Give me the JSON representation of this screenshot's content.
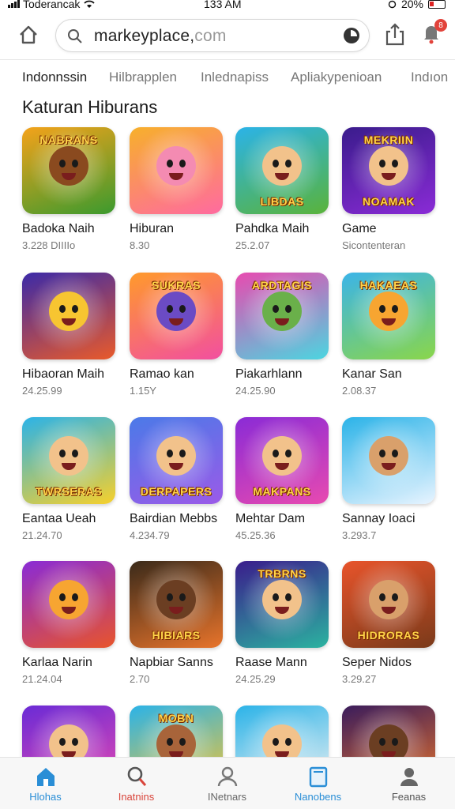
{
  "status_bar": {
    "carrier": "Toderancak",
    "time": "133 AM",
    "battery": "20%"
  },
  "browser": {
    "url_main": "markeyplace,",
    "url_dim": "com",
    "notification_count": "8"
  },
  "tabs": [
    {
      "label": "Indonnssin",
      "active": true
    },
    {
      "label": "Hilbrapplen",
      "active": false
    },
    {
      "label": "Inlednapiss",
      "active": false
    },
    {
      "label": "Apliakypenioan",
      "active": false
    },
    {
      "label": "Indıon",
      "active": false
    }
  ],
  "section": {
    "title": "Katuran Hiburans"
  },
  "apps": [
    {
      "name": "Badoka Naih",
      "meta": "3.228 DIIIIo",
      "banner_top": "NABRANS",
      "banner_bottom": "",
      "bg": [
        "#f4a21a",
        "#3b9a2e"
      ],
      "face": "#8a4a1f"
    },
    {
      "name": "Hiburan",
      "meta": "8.30",
      "banner_top": "",
      "banner_bottom": "",
      "bg": [
        "#f7b02b",
        "#ff6aa0"
      ],
      "face": "#f48bb2"
    },
    {
      "name": "Pahdka Maih",
      "meta": "25.2.07",
      "banner_top": "",
      "banner_bottom": "LIBDAS",
      "bg": [
        "#2bb3e8",
        "#5ab33a"
      ],
      "face": "#f2c28b"
    },
    {
      "name": "Game",
      "meta": "Sicontenteran",
      "banner_top": "MEKRIIN",
      "banner_bottom": "NOAMAK",
      "bg": [
        "#3a1c8c",
        "#8a2bd6"
      ],
      "face": "#f2c28b"
    },
    {
      "name": "Hibaoran Maih",
      "meta": "24.25.99",
      "banner_top": "",
      "banner_bottom": "",
      "bg": [
        "#3b2aa8",
        "#e95a2a"
      ],
      "face": "#f7c531"
    },
    {
      "name": "Ramao kan",
      "meta": "1.15Y",
      "banner_top": "SUKRAS",
      "banner_bottom": "",
      "bg": [
        "#ff9a2b",
        "#f24fa0"
      ],
      "face": "#6b4bc4"
    },
    {
      "name": "Piakarhlann",
      "meta": "24.25.90",
      "banner_top": "ARDTAGIS",
      "banner_bottom": "",
      "bg": [
        "#e84ab0",
        "#4bd6e0"
      ],
      "face": "#6ab04a"
    },
    {
      "name": "Kanar San",
      "meta": "2.08.37",
      "banner_top": "HAKAEAS",
      "banner_bottom": "",
      "bg": [
        "#3bb4e8",
        "#8ad64a"
      ],
      "face": "#f7a531"
    },
    {
      "name": "Eantaa Ueah",
      "meta": "21.24.70",
      "banner_top": "",
      "banner_bottom": "TWRSERAS",
      "bg": [
        "#2bb3e8",
        "#f7d02b"
      ],
      "face": "#f2c28b"
    },
    {
      "name": "Bairdian Mebbs",
      "meta": "4.234.79",
      "banner_top": "",
      "banner_bottom": "DERPAPERS",
      "bg": [
        "#4b7ae8",
        "#9b5ae8"
      ],
      "face": "#f2c28b"
    },
    {
      "name": "Mehtar Dam",
      "meta": "45.25.36",
      "banner_top": "",
      "banner_bottom": "MAKPANS",
      "bg": [
        "#8a2bd6",
        "#e84ab0"
      ],
      "face": "#f2c28b"
    },
    {
      "name": "Sannay Ioaci",
      "meta": "3.293.7",
      "banner_top": "",
      "banner_bottom": "",
      "bg": [
        "#2bb3e8",
        "#e8f4ff"
      ],
      "face": "#d9a06b"
    },
    {
      "name": "Karlaa Narin",
      "meta": "21.24.04",
      "banner_top": "",
      "banner_bottom": "",
      "bg": [
        "#8a2bd6",
        "#e8542b"
      ],
      "face": "#f7a531"
    },
    {
      "name": "Napbiar Sanns",
      "meta": "2.70",
      "banner_top": "",
      "banner_bottom": "HIBIARS",
      "bg": [
        "#3a2a1a",
        "#e8742b"
      ],
      "face": "#6b3e22"
    },
    {
      "name": "Raase Mann",
      "meta": "24.25.29",
      "banner_top": "TRBRNS",
      "banner_bottom": "",
      "bg": [
        "#3a1c8c",
        "#2bb3a0"
      ],
      "face": "#f2c28b"
    },
    {
      "name": "Seper Nidos",
      "meta": "3.29.27",
      "banner_top": "",
      "banner_bottom": "HIDRORAS",
      "bg": [
        "#e8542b",
        "#7a3a1a"
      ],
      "face": "#d9a06b"
    },
    {
      "name": "",
      "meta": "",
      "banner_top": "",
      "banner_bottom": "",
      "bg": [
        "#6a2bd6",
        "#e84ab0"
      ],
      "face": "#f2c28b"
    },
    {
      "name": "",
      "meta": "",
      "banner_top": "MOBN",
      "banner_bottom": "",
      "bg": [
        "#2bb3e8",
        "#f7c531"
      ],
      "face": "#a8643a"
    },
    {
      "name": "",
      "meta": "",
      "banner_top": "",
      "banner_bottom": "",
      "bg": [
        "#2bb3e8",
        "#f2f2f2"
      ],
      "face": "#f2c28b"
    },
    {
      "name": "",
      "meta": "",
      "banner_top": "",
      "banner_bottom": "",
      "bg": [
        "#3a1c5c",
        "#e8742b"
      ],
      "face": "#6b3e22"
    }
  ],
  "bottom_nav": [
    {
      "label": "Hlohas",
      "color": "#2a8ed6",
      "icon": "home-icon"
    },
    {
      "label": "Inatnins",
      "color": "#d9453b",
      "icon": "search-icon"
    },
    {
      "label": "INetnars",
      "color": "#666666",
      "icon": "user-icon"
    },
    {
      "label": "Nanobens",
      "color": "#2a8ed6",
      "icon": "apps-icon"
    },
    {
      "label": "Feanas",
      "color": "#555555",
      "icon": "profile-icon"
    }
  ]
}
